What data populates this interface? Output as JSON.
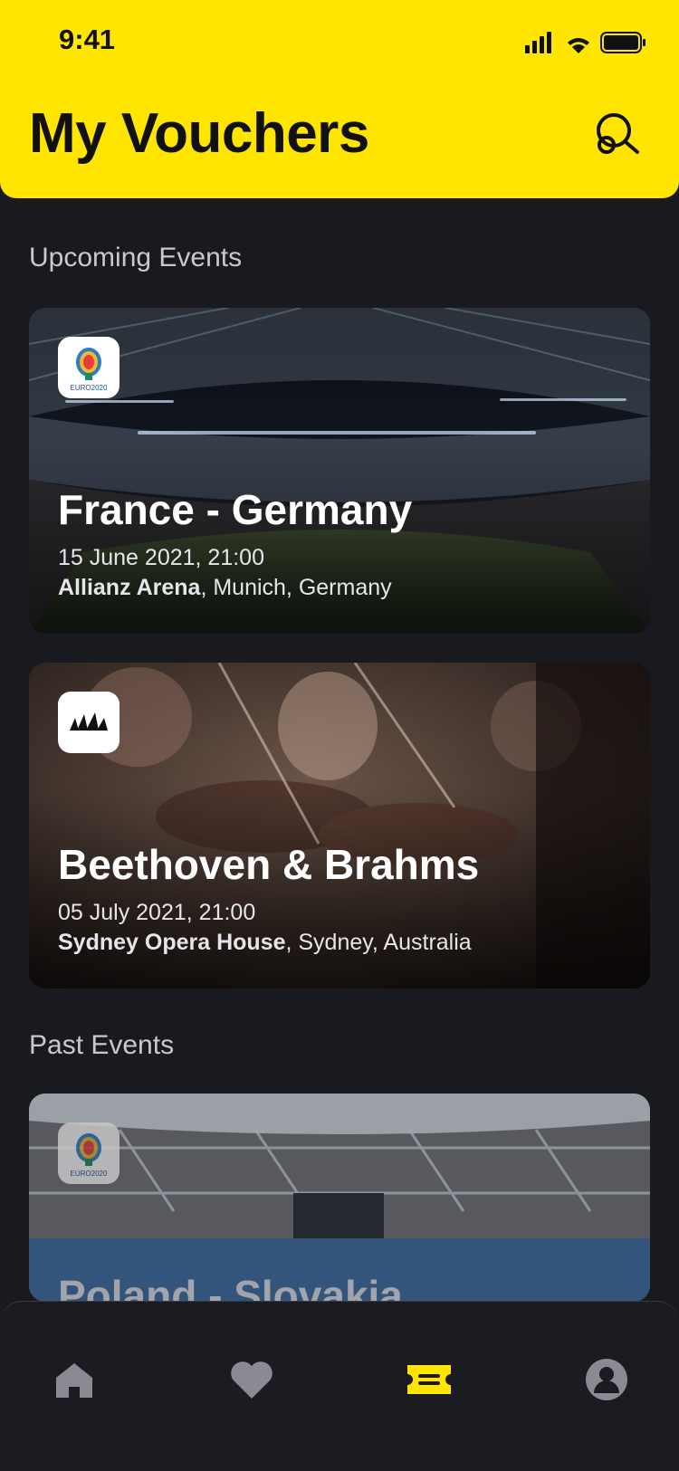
{
  "status_bar": {
    "time": "9:41"
  },
  "header": {
    "title": "My Vouchers"
  },
  "sections": {
    "upcoming_title": "Upcoming Events",
    "past_title": "Past Events"
  },
  "upcoming": [
    {
      "title": "France - Germany",
      "date": "15 June 2021, 21:00",
      "venue_name": "Allianz Arena",
      "venue_location": ", Munich, Germany",
      "logo_text": "EURO2020"
    },
    {
      "title": "Beethoven & Brahms",
      "date": "05 July 2021, 21:00",
      "venue_name": "Sydney Opera House",
      "venue_location": ", Sydney, Australia"
    }
  ],
  "past": [
    {
      "title": "Poland - Slovakia",
      "logo_text": "EURO2020"
    }
  ],
  "tabbar": {
    "items": [
      "home-icon",
      "heart-icon",
      "ticket-icon",
      "profile-icon"
    ],
    "active": "ticket-icon",
    "active_color": "#FFE500",
    "inactive_color": "#8a8a92"
  },
  "colors": {
    "accent": "#FFE500",
    "background": "#191920"
  }
}
